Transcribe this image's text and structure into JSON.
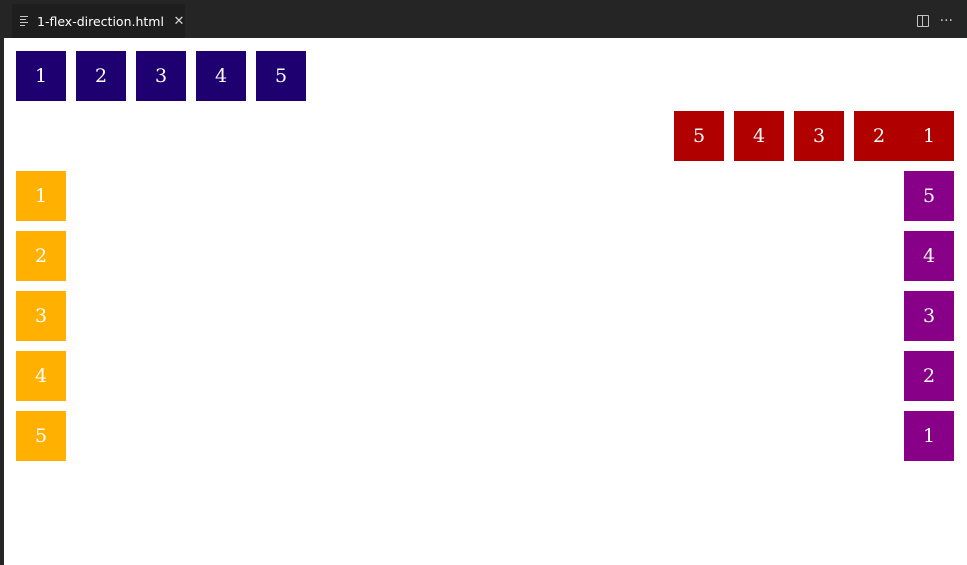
{
  "editor": {
    "tab": {
      "label": "1-flex-direction.html",
      "icon": "preview-lines-icon",
      "close_glyph": "✕"
    },
    "actions": {
      "split_icon": "split-editor-icon",
      "more_glyph": "···"
    }
  },
  "colors": {
    "navy": "#1f0070",
    "red": "#b00000",
    "amber": "#ffb000",
    "purple": "#880088",
    "chrome": "#252526"
  },
  "containers": {
    "row": [
      "1",
      "2",
      "3",
      "4",
      "5"
    ],
    "row_reverse": [
      "1",
      "2",
      "3",
      "4",
      "5"
    ],
    "column": [
      "1",
      "2",
      "3",
      "4",
      "5"
    ],
    "column_reverse": [
      "1",
      "2",
      "3",
      "4",
      "5"
    ]
  }
}
